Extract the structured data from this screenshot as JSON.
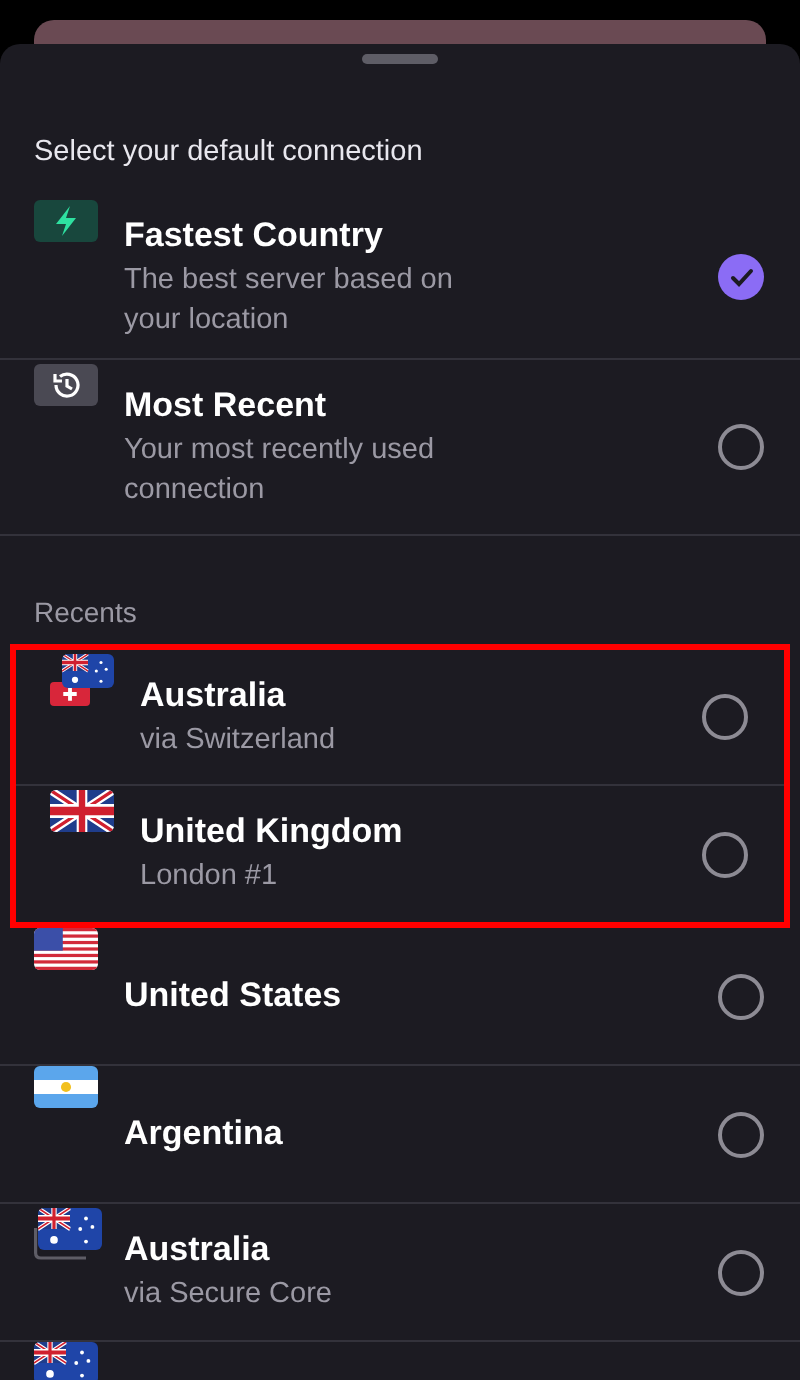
{
  "sheet": {
    "title": "Select your default connection"
  },
  "options": [
    {
      "kind": "fastest",
      "title": "Fastest Country",
      "subtitle": "The best server based on your location",
      "selected": true
    },
    {
      "kind": "recent",
      "title": "Most Recent",
      "subtitle": "Your most recently used connection",
      "selected": false
    }
  ],
  "recents": {
    "label": "Recents",
    "items": [
      {
        "kind": "via",
        "title": "Australia",
        "subtitle": "via Switzerland",
        "selected": false,
        "highlighted": true
      },
      {
        "kind": "plain",
        "title": "United Kingdom",
        "subtitle": "London #1",
        "selected": false,
        "highlighted": true
      },
      {
        "kind": "plain",
        "title": "United States",
        "selected": false,
        "highlighted": false
      },
      {
        "kind": "plain",
        "title": "Argentina",
        "selected": false,
        "highlighted": false
      },
      {
        "kind": "secure_core",
        "title": "Australia",
        "subtitle": "via Secure Core",
        "selected": false,
        "highlighted": false
      },
      {
        "kind": "plain"
      }
    ]
  }
}
